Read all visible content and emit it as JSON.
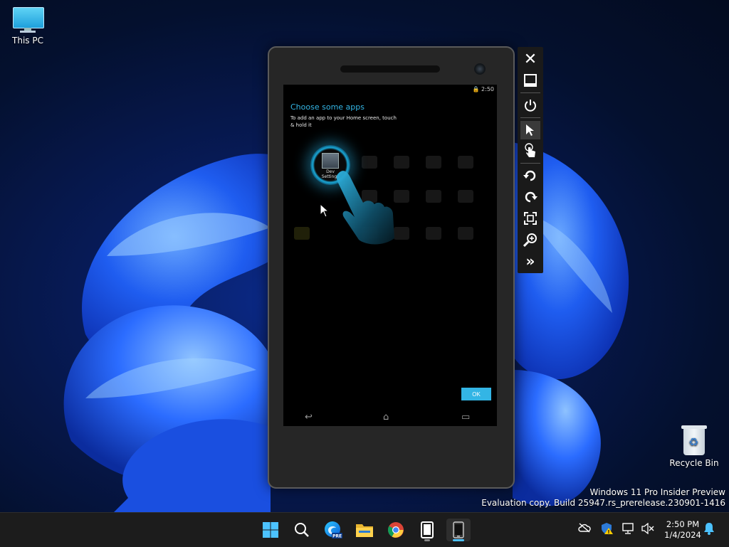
{
  "desktop": {
    "icons": [
      {
        "label": "This PC"
      },
      {
        "label": "Recycle Bin"
      }
    ],
    "watermark": {
      "line1": "Windows 11 Pro Insider Preview",
      "line2": "Evaluation copy. Build 25947.rs_prerelease.230901-1416"
    }
  },
  "emulator": {
    "status_time": "2:50",
    "screen_title": "Choose some apps",
    "screen_description": "To add an app to your Home screen, touch & hold it",
    "highlighted_app": "Dev Settings",
    "ok_label": "OK",
    "toolbar": [
      "close-icon",
      "minimize-icon",
      "power-icon",
      "pointer-icon",
      "touch-icon",
      "rotate-left-icon",
      "rotate-right-icon",
      "fit-screen-icon",
      "zoom-icon",
      "more-icon"
    ]
  },
  "taskbar": {
    "items": [
      "start",
      "search",
      "edge-beta",
      "file-explorer",
      "chrome",
      "device-manager",
      "emulator"
    ],
    "edge_badge": "PRE",
    "clock_time": "2:50 PM",
    "clock_date": "1/4/2024"
  },
  "colors": {
    "accent": "#33b5e5",
    "taskbar": "#1c1c1c",
    "windows_blue": "#4cc2ff"
  }
}
